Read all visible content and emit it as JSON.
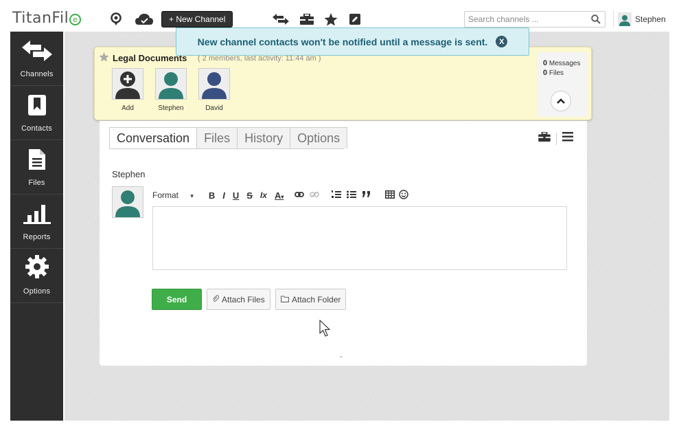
{
  "app": {
    "logo_text": "TitanFil",
    "logo_mark": "e",
    "brand_color": "#3fae49"
  },
  "topbar": {
    "new_channel_label": "+ New Channel",
    "search_placeholder": "Search channels ...",
    "user_name": "Stephen",
    "icons": [
      "support-icon",
      "cloud-icon",
      "transfer-arrows-icon",
      "toolbox-icon",
      "star-icon",
      "edit-icon",
      "search-icon"
    ]
  },
  "sidebar": {
    "items": [
      {
        "label": "Channels",
        "icon": "transfer-arrows-icon"
      },
      {
        "label": "Contacts",
        "icon": "bookmark-icon"
      },
      {
        "label": "Files",
        "icon": "file-icon"
      },
      {
        "label": "Reports",
        "icon": "bar-chart-icon"
      },
      {
        "label": "Options",
        "icon": "gear-icon"
      }
    ]
  },
  "notification": {
    "text": "New channel contacts won't be notified until a message is sent.",
    "close_glyph": "X"
  },
  "channel": {
    "title": "Legal Documents",
    "meta": "( 2 members, last activity: 11:44 am )",
    "members": [
      {
        "name": "Add",
        "color": "#333333"
      },
      {
        "name": "Stephen",
        "color": "#2f7f74"
      },
      {
        "name": "David",
        "color": "#3a4f82"
      }
    ],
    "stats": {
      "messages_count": "0",
      "messages_label": "Messages",
      "files_count": "0",
      "files_label": "Files"
    }
  },
  "tabs": [
    {
      "label": "Conversation",
      "active": true
    },
    {
      "label": "Files",
      "active": false
    },
    {
      "label": "History",
      "active": false
    },
    {
      "label": "Options",
      "active": false
    }
  ],
  "composer": {
    "author": "Stephen",
    "format_label": "Format",
    "toolbar_buttons": [
      "B",
      "I",
      "U",
      "S",
      "Ix",
      "A"
    ],
    "send_label": "Send",
    "attach_files_label": "Attach Files",
    "attach_folder_label": "Attach Folder",
    "expand_glyph": "ˆ"
  }
}
